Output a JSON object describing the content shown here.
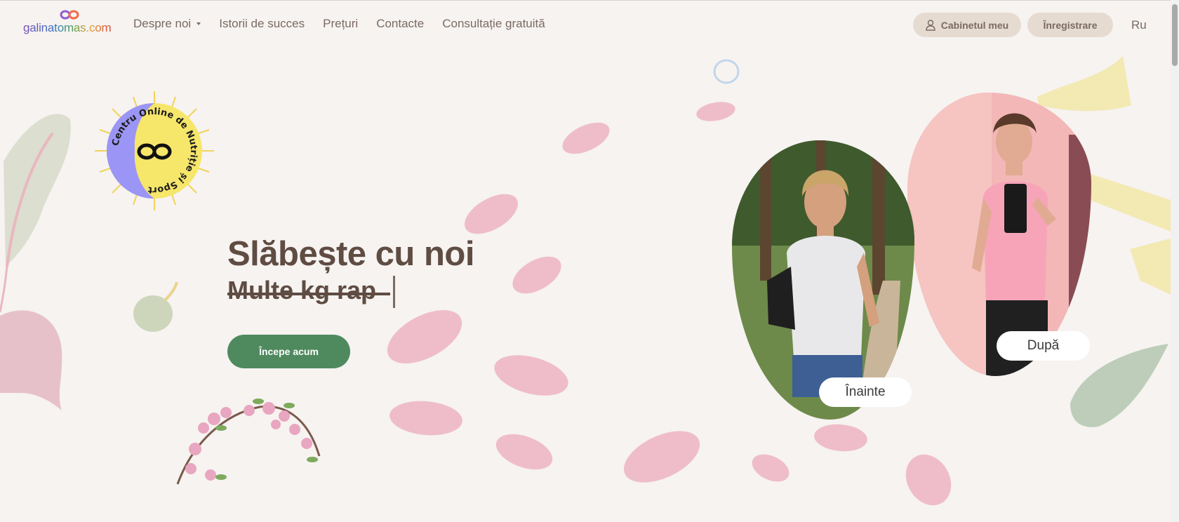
{
  "header": {
    "logo_text": "galinatomas.com",
    "nav": [
      {
        "label": "Despre noi",
        "has_dropdown": true
      },
      {
        "label": "Istorii de succes"
      },
      {
        "label": "Prețuri"
      },
      {
        "label": "Contacte"
      },
      {
        "label": "Consultație gratuită"
      }
    ],
    "cabinet_label": "Cabinetul meu",
    "register_label": "Înregistrare",
    "lang_label": "Ru"
  },
  "badge": {
    "ring_text": "Centru Online de Nutriție și Sport"
  },
  "hero": {
    "title": "Slăbește cu noi",
    "rotating_text": "Multe kg rap",
    "cta_label": "Începe acum"
  },
  "photos": {
    "before_label": "Înainte",
    "after_label": "După"
  },
  "colors": {
    "background": "#f6f3f1",
    "text_brown": "#5f4c42",
    "cta_green": "#4f8a5f",
    "pill_beige": "#e6dbd0",
    "badge_purple": "#9b95f5",
    "badge_yellow": "#f6e66a"
  }
}
